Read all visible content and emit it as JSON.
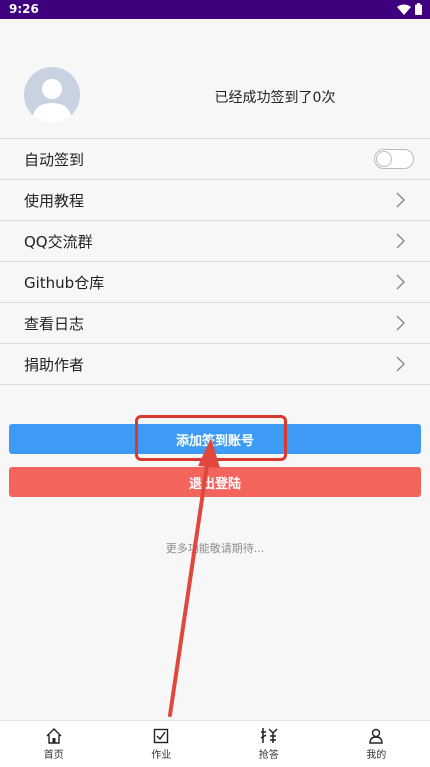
{
  "status_bar": {
    "time": "9:26"
  },
  "profile": {
    "sign_text": "已经成功签到了0次"
  },
  "menu": {
    "items": [
      {
        "label": "自动签到",
        "control": "toggle"
      },
      {
        "label": "使用教程",
        "control": "chevron"
      },
      {
        "label": "QQ交流群",
        "control": "chevron"
      },
      {
        "label": "Github仓库",
        "control": "chevron"
      },
      {
        "label": "查看日志",
        "control": "chevron"
      },
      {
        "label": "捐助作者",
        "control": "chevron"
      }
    ],
    "auto_sign_enabled": false
  },
  "buttons": {
    "add_account": "添加签到账号",
    "logout": "退出登陆"
  },
  "footer_note": "更多功能敬请期待...",
  "tabbar": {
    "items": [
      {
        "label": "首页",
        "icon": "home-icon"
      },
      {
        "label": "作业",
        "icon": "homework-icon"
      },
      {
        "label": "抢答",
        "icon": "rush-answer-icon"
      },
      {
        "label": "我的",
        "icon": "profile-icon"
      }
    ]
  },
  "colors": {
    "status_bar": "#3f007e",
    "add_button": "#3d9bf5",
    "logout_button": "#f2645c",
    "highlight": "#d9392f"
  }
}
